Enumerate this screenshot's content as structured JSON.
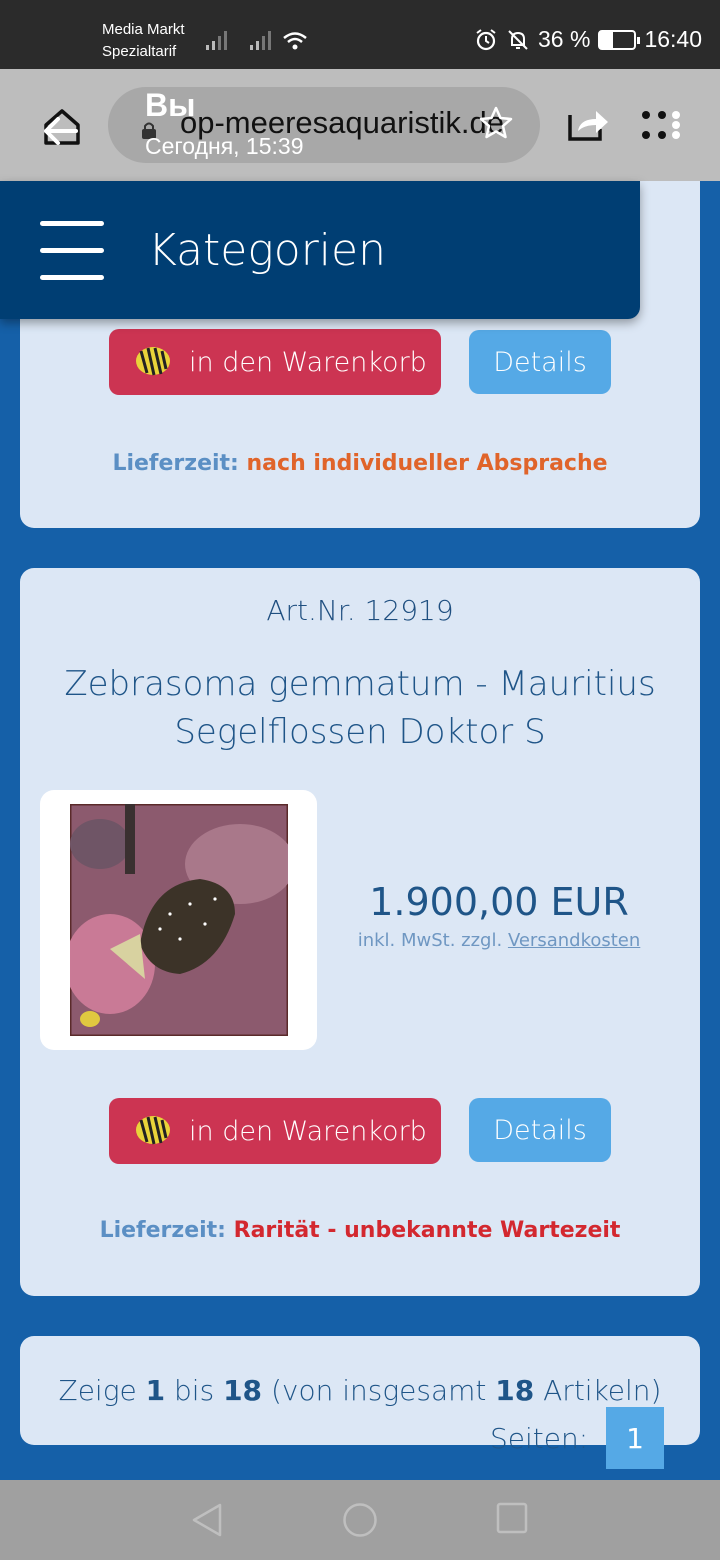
{
  "status_bar": {
    "carrier_line1": "Media Markt",
    "carrier_line2": "Spezialtarif",
    "battery_percent": "36 %",
    "battery_level": 0.36,
    "time": "16:40"
  },
  "browser": {
    "url": "op-meeresaquaristik.de",
    "tab_owner": "Вы",
    "tab_time": "Сегодня, 15:39"
  },
  "header": {
    "title": "Kategorien"
  },
  "top_card": {
    "cart_label": "in den Warenkorb",
    "details_label": "Details",
    "delivery_label": "Lieferzeit:",
    "delivery_value": "nach individueller Absprache",
    "delivery_color": "#e0642a"
  },
  "product": {
    "artnr": "Art.Nr. 12919",
    "title": "Zebrasoma gemmatum - Mauritius Segelflossen Doktor S",
    "price": "1.900,00 EUR",
    "tax_prefix": "inkl. MwSt. zzgl.",
    "shipping_link": "Versandkosten",
    "cart_label": "in den Warenkorb",
    "details_label": "Details",
    "delivery_label": "Lieferzeit:",
    "delivery_value": "Rarität - unbekannte Wartezeit",
    "delivery_color": "#d3282f"
  },
  "pager": {
    "show": "Zeige",
    "from": "1",
    "to_word": "bis",
    "to": "18",
    "total_prefix": "(von insgesamt",
    "total": "18",
    "total_suffix": "Artikeln)",
    "pages_label": "Seiten:",
    "current_page": "1"
  },
  "colors": {
    "page_bg": "#1560a8",
    "header_bg": "#003e73",
    "card_bg": "#dce7f5",
    "cart_button": "#cc3452",
    "details_button": "#55a9e6"
  }
}
